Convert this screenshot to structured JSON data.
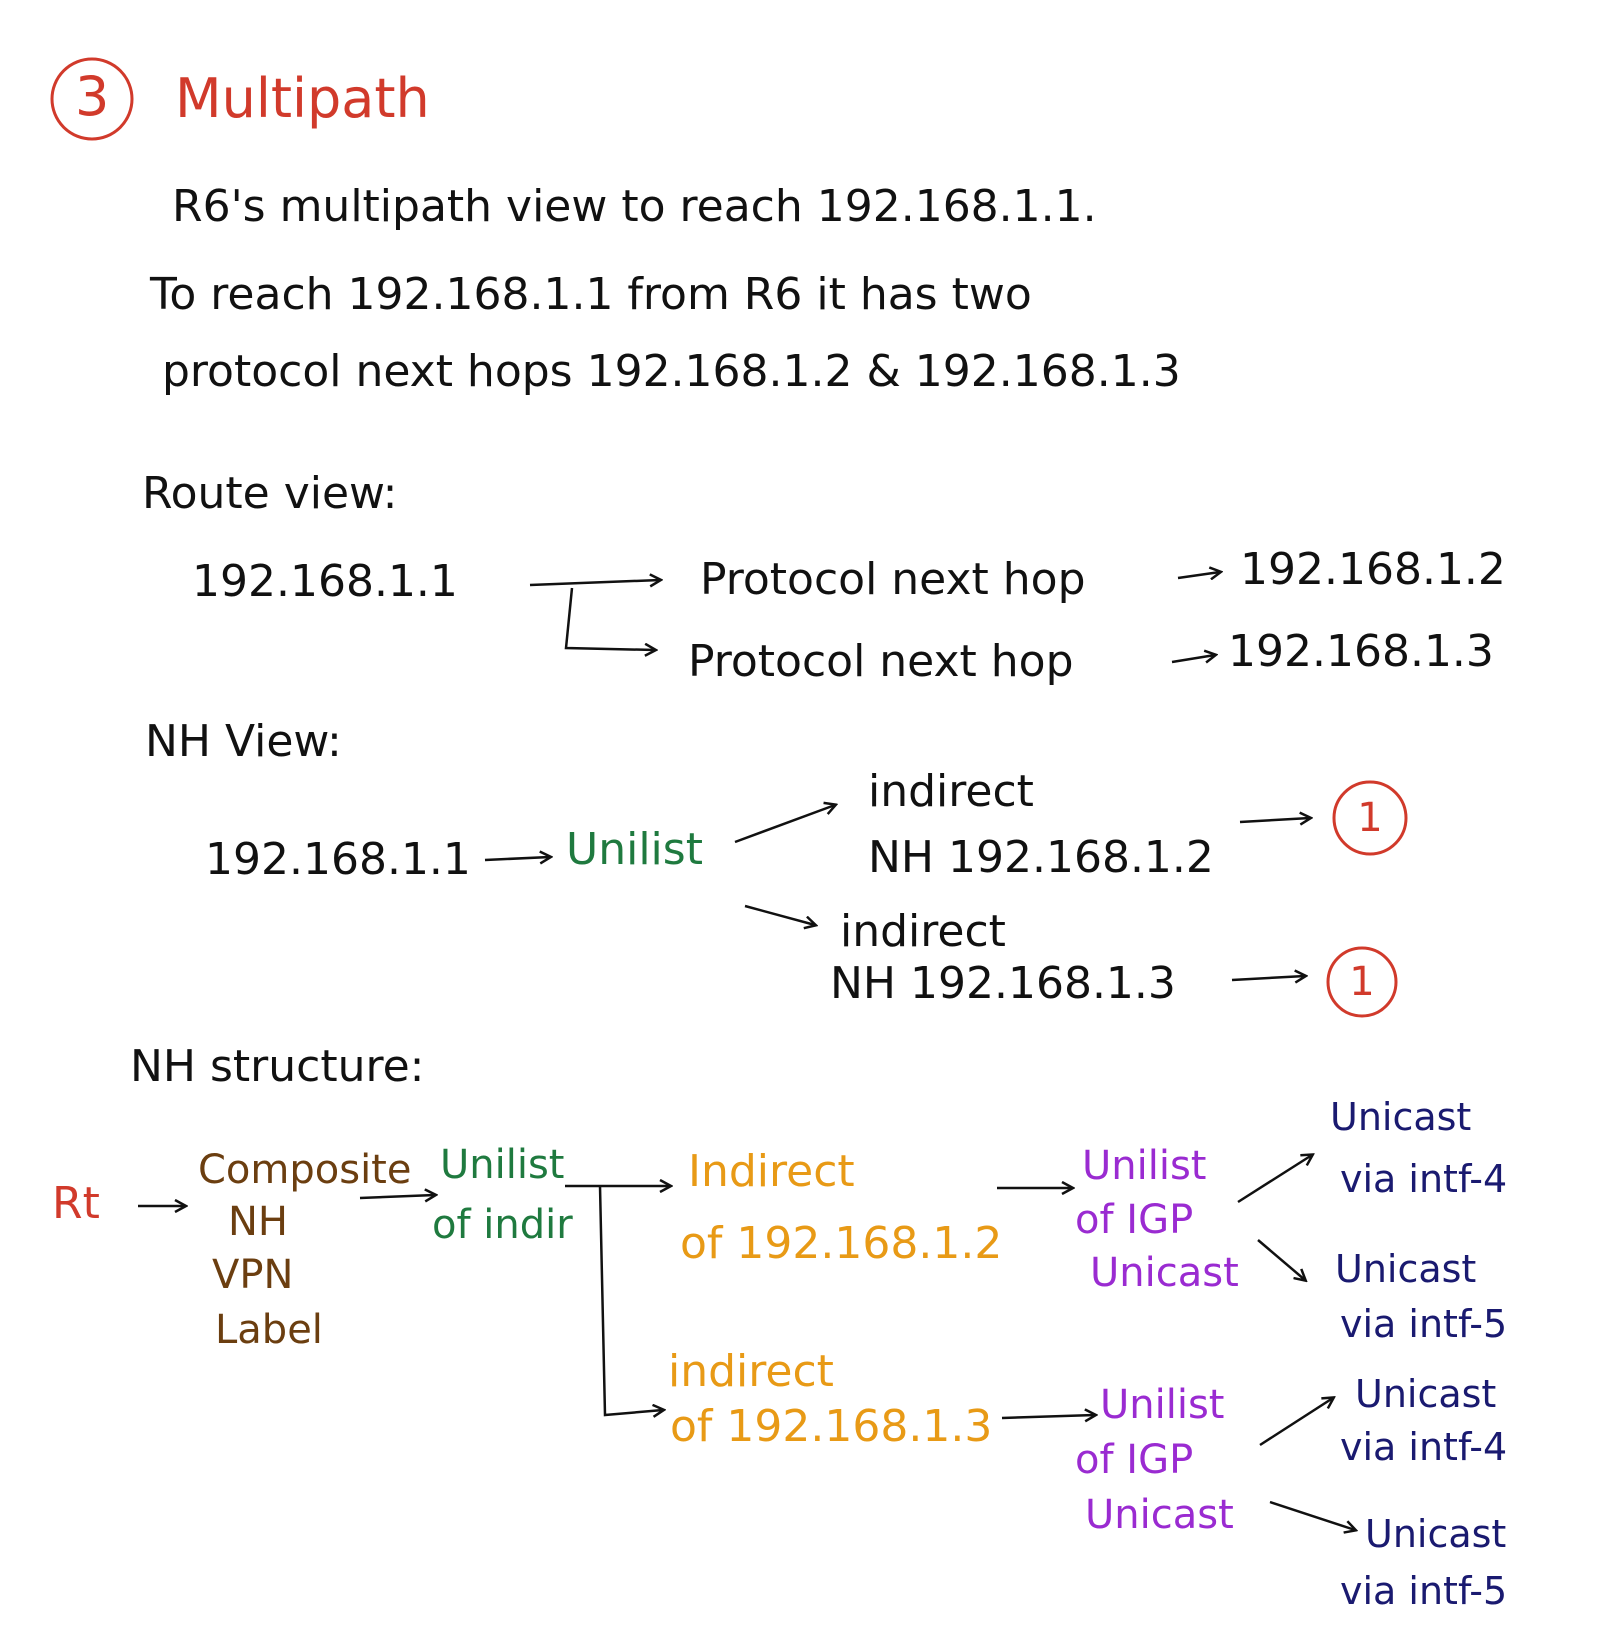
{
  "heading": {
    "number": "3",
    "title": "Multipath"
  },
  "intro": {
    "line1": "R6's multipath view to reach 192.168.1.1.",
    "line2": "To reach 192.168.1.1 from R6 it has two",
    "line3": "protocol next hops 192.168.1.2 & 192.168.1.3"
  },
  "route_view": {
    "label": "Route view:",
    "prefix": "192.168.1.1",
    "branches": [
      {
        "text": "Protocol next hop",
        "nh": "192.168.1.2"
      },
      {
        "text": "Protocol next hop",
        "nh": "192.168.1.3"
      }
    ]
  },
  "nh_view": {
    "label": "NH View:",
    "prefix": "192.168.1.1",
    "unilist": "Unilist",
    "branches": [
      {
        "line1": "indirect",
        "line2": "NH 192.168.1.2",
        "marker": "1"
      },
      {
        "line1": "indirect",
        "line2": "NH 192.168.1.3",
        "marker": "1"
      }
    ]
  },
  "nh_structure": {
    "label": "NH structure:",
    "rt": "Rt",
    "composite": [
      "Composite",
      "NH",
      "VPN",
      "Label"
    ],
    "unilist_indirect": [
      "Unilist",
      "of indir"
    ],
    "indirects": [
      {
        "line1": "Indirect",
        "line2": "of 192.168.1.2",
        "igp": [
          "Unilist",
          "of IGP",
          "Unicast"
        ],
        "unicasts": [
          {
            "line1": "Unicast",
            "line2": "via intf-4"
          },
          {
            "line1": "Unicast",
            "line2": "via intf-5"
          }
        ]
      },
      {
        "line1": "indirect",
        "line2": "of 192.168.1.3",
        "igp": [
          "Unilist",
          "of IGP",
          "Unicast"
        ],
        "unicasts": [
          {
            "line1": "Unicast",
            "line2": "via intf-4"
          },
          {
            "line1": "Unicast",
            "line2": "via intf-5"
          }
        ]
      }
    ]
  },
  "colors": {
    "ink": "#111111",
    "red": "#d13a2b",
    "green": "#1f7a3f",
    "brown": "#6b3e10",
    "orange": "#e89a16",
    "purple": "#9a2bd1",
    "navy": "#1a1a70"
  }
}
